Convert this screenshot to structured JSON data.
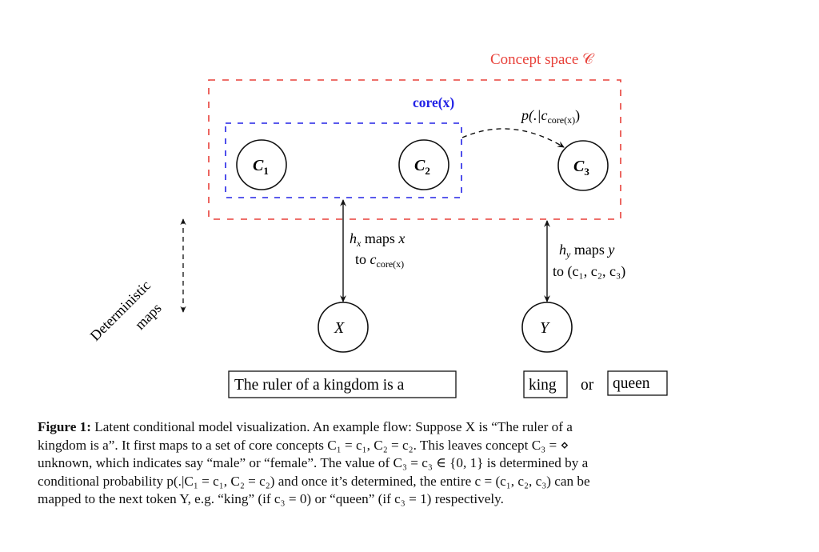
{
  "diagram": {
    "concept_space_label": "Concept space 𝒞",
    "core_label": "core(x)",
    "conditional_label_main": "p(.|c",
    "conditional_label_sub": "core(x)",
    "conditional_label_close": ")",
    "nodes": {
      "c1": {
        "letter": "C",
        "sub": "1"
      },
      "c2": {
        "letter": "C",
        "sub": "2"
      },
      "c3": {
        "letter": "C",
        "sub": "3"
      },
      "x": {
        "letter": "X"
      },
      "y": {
        "letter": "Y"
      }
    },
    "hx_label_line1_h": "h",
    "hx_label_line1_sub": "x",
    "hx_label_line1_rest": " maps ",
    "hx_label_line1_var": "x",
    "hx_label_line2_to": "to ",
    "hx_label_line2_c": "c",
    "hx_label_line2_sub": "core(x)",
    "hy_label_line1_h": "h",
    "hy_label_line1_sub": "y",
    "hy_label_line1_rest": " maps ",
    "hy_label_line1_var": "y",
    "hy_label_line2": "to (c₁, c₂, c₃)",
    "deterministic_label_1": "Deterministic",
    "deterministic_label_2": "maps",
    "input_text": "The ruler of a kingdom is a",
    "output_option_1": "king",
    "output_or": "or",
    "output_option_2": "queen",
    "colors": {
      "concept_space": "#e8413a",
      "core": "#2323e6",
      "ink": "#111111"
    }
  },
  "caption": {
    "figure_label": "Figure 1:",
    "lines": [
      " Latent conditional model visualization. An example flow: Suppose X is “The ruler of a",
      "kingdom is a”. It first maps to a set of core concepts C₁ = c₁, C₂ = c₂. This leaves concept C₃ = ⋄",
      "unknown, which indicates say “male” or “female”. The value of C₃ = c₃ ∈ {0, 1} is determined by a",
      "conditional probability p(.|C₁ = c₁, C₂ = c₂) and once it’s determined, the entire c = (c₁, c₂, c₃) can be",
      "mapped to the next token Y, e.g. “king” (if c₃ = 0) or “queen” (if c₃ = 1) respectively."
    ]
  }
}
